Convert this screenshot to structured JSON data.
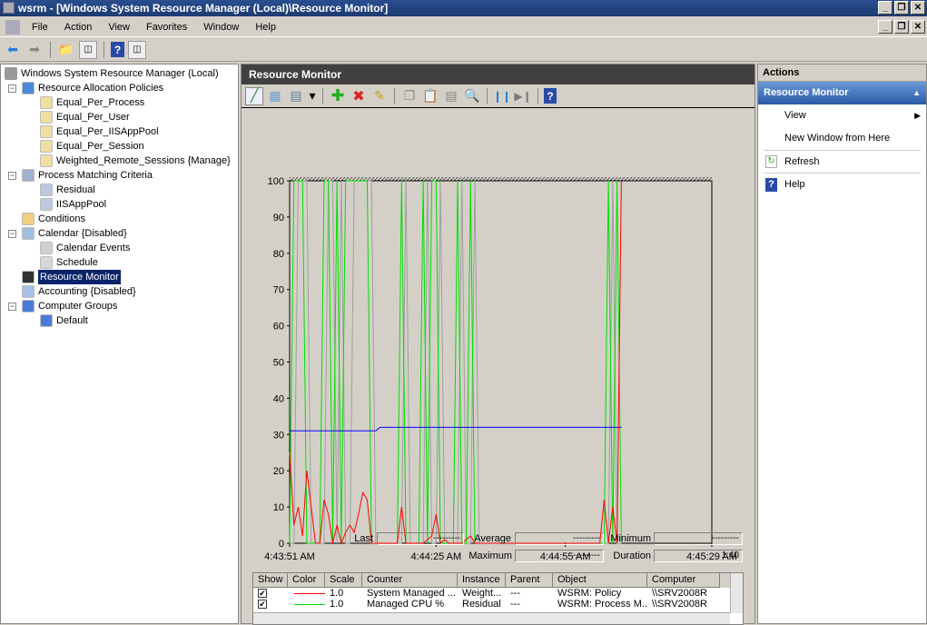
{
  "window": {
    "title": "wsrm - [Windows System Resource Manager (Local)\\Resource Monitor]",
    "buttons": [
      "_",
      "❐",
      "✕"
    ]
  },
  "menu": [
    "File",
    "Action",
    "View",
    "Favorites",
    "Window",
    "Help"
  ],
  "toolbar": {
    "icons": [
      "back-icon",
      "forward-icon",
      "up-folder-icon",
      "show-hide-tree-icon",
      "help-icon",
      "show-hide-action-pane-icon"
    ]
  },
  "tree": {
    "root": "Windows System Resource Manager (Local)",
    "items": [
      {
        "label": "Resource Allocation Policies",
        "level": 1,
        "expanded": true
      },
      {
        "label": "Equal_Per_Process",
        "level": 2
      },
      {
        "label": "Equal_Per_User",
        "level": 2
      },
      {
        "label": "Equal_Per_IISAppPool",
        "level": 2
      },
      {
        "label": "Equal_Per_Session",
        "level": 2
      },
      {
        "label": "Weighted_Remote_Sessions  {Manage}",
        "level": 2
      },
      {
        "label": "Process Matching Criteria",
        "level": 1,
        "expanded": true
      },
      {
        "label": "Residual",
        "level": 2
      },
      {
        "label": "IISAppPool",
        "level": 2
      },
      {
        "label": "Conditions",
        "level": 1
      },
      {
        "label": "Calendar  {Disabled}",
        "level": 1,
        "expanded": true
      },
      {
        "label": "Calendar Events",
        "level": 2
      },
      {
        "label": "Schedule",
        "level": 2
      },
      {
        "label": "Resource Monitor",
        "level": 1,
        "selected": true
      },
      {
        "label": "Accounting  {Disabled}",
        "level": 1
      },
      {
        "label": "Computer Groups",
        "level": 1,
        "expanded": true
      },
      {
        "label": "Default",
        "level": 2
      }
    ]
  },
  "center": {
    "title": "Resource Monitor",
    "chart_toolbar": [
      "view-graph-icon",
      "view-histogram-icon",
      "view-report-icon",
      "dropdown-icon",
      "add-counter-icon",
      "delete-counter-icon",
      "highlight-icon",
      "copy-properties-icon",
      "paste-counter-icon",
      "properties-icon",
      "zoom-icon",
      "freeze-display-icon",
      "update-data-icon",
      "help-icon"
    ],
    "stats": {
      "last_label": "Last",
      "last": "---------",
      "average_label": "Average",
      "average": "---------",
      "minimum_label": "Minimum",
      "minimum": "---------",
      "maximum_label": "Maximum",
      "maximum": "---------",
      "duration_label": "Duration",
      "duration": "1:40"
    },
    "list": {
      "columns": [
        "Show",
        "Color",
        "Scale",
        "Counter",
        "Instance",
        "Parent",
        "Object",
        "Computer"
      ],
      "rows": [
        {
          "show": true,
          "color": "#ff0000",
          "scale": "1.0",
          "counter": "System Managed ...",
          "instance": "Weight...",
          "parent": "---",
          "object": "WSRM: Policy",
          "computer": "\\\\SRV2008R"
        },
        {
          "show": true,
          "color": "#00e000",
          "scale": "1.0",
          "counter": "Managed CPU %",
          "instance": "Residual",
          "parent": "---",
          "object": "WSRM: Process M...",
          "computer": "\\\\SRV2008R"
        }
      ]
    }
  },
  "chart_data": {
    "type": "line",
    "ylim": [
      0,
      100
    ],
    "yticks": [
      0,
      10,
      20,
      30,
      40,
      50,
      60,
      70,
      80,
      90,
      100
    ],
    "xticks": [
      "4:43:51 AM",
      "4:44:25 AM",
      "4:44:55 AM",
      "4:45:29 AM"
    ],
    "x_unit": "seconds from 4:43:51 AM",
    "x_range": [
      0,
      98
    ],
    "series": [
      {
        "color": "#a0a0a0",
        "values": [
          0,
          0,
          100,
          100,
          100,
          0,
          0,
          0,
          0,
          100,
          100,
          0,
          100,
          0,
          0,
          100,
          100,
          100,
          100,
          100,
          0,
          0,
          0,
          0,
          0,
          0,
          0,
          100,
          0,
          0,
          0,
          0,
          100,
          0,
          0,
          100,
          0,
          0,
          0,
          0,
          100,
          0,
          0,
          100,
          0,
          0,
          0,
          0,
          0,
          0,
          0,
          0,
          0,
          0,
          0,
          0,
          0,
          0,
          0,
          0,
          0,
          0,
          0,
          0,
          0,
          0,
          0,
          0,
          0,
          0,
          0,
          0,
          0,
          0,
          0,
          100,
          0,
          0
        ]
      },
      {
        "color": "#00e000",
        "values": [
          0,
          100,
          100,
          100,
          0,
          0,
          0,
          0,
          100,
          100,
          0,
          100,
          0,
          100,
          100,
          100,
          100,
          100,
          100,
          0,
          0,
          0,
          0,
          0,
          0,
          0,
          100,
          0,
          0,
          0,
          0,
          100,
          0,
          100,
          100,
          0,
          0,
          0,
          0,
          100,
          0,
          0,
          100,
          0,
          0,
          0,
          0,
          0,
          0,
          0,
          0,
          0,
          0,
          0,
          0,
          0,
          0,
          0,
          0,
          0,
          0,
          0,
          0,
          0,
          0,
          0,
          0,
          0,
          0,
          0,
          0,
          0,
          0,
          0,
          100,
          0,
          100,
          0
        ]
      },
      {
        "color": "#0000ff",
        "values": [
          31,
          31,
          31,
          31,
          31,
          31,
          31,
          31,
          31,
          31,
          31,
          31,
          31,
          31,
          31,
          31,
          31,
          31,
          31,
          31,
          31,
          32,
          32,
          32,
          32,
          32,
          32,
          32,
          32,
          32,
          32,
          32,
          32,
          32,
          32,
          32,
          32,
          32,
          32,
          32,
          32,
          32,
          32,
          32,
          32,
          32,
          32,
          32,
          32,
          32,
          32,
          32,
          32,
          32,
          32,
          32,
          32,
          32,
          32,
          32,
          32,
          32,
          32,
          32,
          32,
          32,
          32,
          32,
          32,
          32,
          32,
          32,
          32,
          32,
          32,
          32,
          32,
          32
        ]
      },
      {
        "color": "#ff0000",
        "values": [
          25,
          5,
          10,
          2,
          20,
          10,
          0,
          0,
          12,
          8,
          0,
          5,
          0,
          3,
          5,
          3,
          8,
          14,
          12,
          0,
          0,
          0,
          0,
          0,
          0,
          0,
          10,
          0,
          0,
          0,
          0,
          0,
          1,
          2,
          8,
          0,
          1,
          0,
          0,
          0,
          0,
          1,
          2,
          0,
          0,
          0,
          0,
          0,
          0,
          0,
          0,
          0,
          0,
          0,
          0,
          0,
          0,
          0,
          0,
          0,
          0,
          0,
          0,
          0,
          0,
          0,
          0,
          0,
          0,
          0,
          0,
          0,
          0,
          12,
          0,
          10,
          0,
          100
        ]
      }
    ]
  },
  "actions": {
    "title": "Actions",
    "section": "Resource Monitor",
    "items": [
      {
        "label": "View",
        "submenu": true
      },
      {
        "label": "New Window from Here"
      },
      {
        "label": "Refresh",
        "icon": "refresh-icon"
      },
      {
        "label": "Help",
        "icon": "help-icon"
      }
    ]
  }
}
